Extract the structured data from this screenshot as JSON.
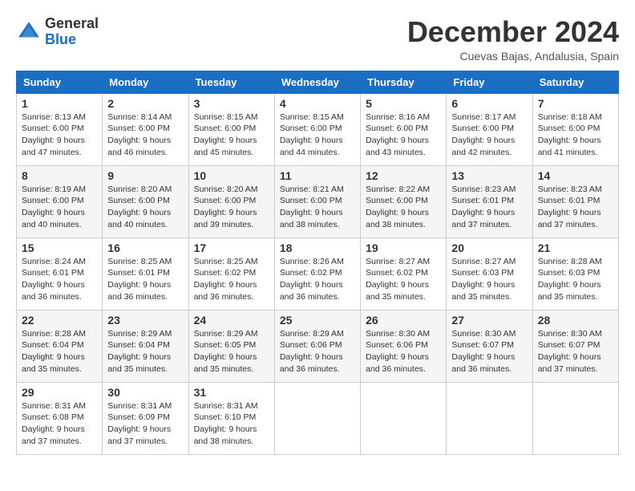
{
  "header": {
    "logo_line1": "General",
    "logo_line2": "Blue",
    "month": "December 2024",
    "location": "Cuevas Bajas, Andalusia, Spain"
  },
  "weekdays": [
    "Sunday",
    "Monday",
    "Tuesday",
    "Wednesday",
    "Thursday",
    "Friday",
    "Saturday"
  ],
  "weeks": [
    [
      {
        "day": 1,
        "sunrise": "8:13 AM",
        "sunset": "6:00 PM",
        "daylight": "9 hours and 47 minutes."
      },
      {
        "day": 2,
        "sunrise": "8:14 AM",
        "sunset": "6:00 PM",
        "daylight": "9 hours and 46 minutes."
      },
      {
        "day": 3,
        "sunrise": "8:15 AM",
        "sunset": "6:00 PM",
        "daylight": "9 hours and 45 minutes."
      },
      {
        "day": 4,
        "sunrise": "8:15 AM",
        "sunset": "6:00 PM",
        "daylight": "9 hours and 44 minutes."
      },
      {
        "day": 5,
        "sunrise": "8:16 AM",
        "sunset": "6:00 PM",
        "daylight": "9 hours and 43 minutes."
      },
      {
        "day": 6,
        "sunrise": "8:17 AM",
        "sunset": "6:00 PM",
        "daylight": "9 hours and 42 minutes."
      },
      {
        "day": 7,
        "sunrise": "8:18 AM",
        "sunset": "6:00 PM",
        "daylight": "9 hours and 41 minutes."
      }
    ],
    [
      {
        "day": 8,
        "sunrise": "8:19 AM",
        "sunset": "6:00 PM",
        "daylight": "9 hours and 40 minutes."
      },
      {
        "day": 9,
        "sunrise": "8:20 AM",
        "sunset": "6:00 PM",
        "daylight": "9 hours and 40 minutes."
      },
      {
        "day": 10,
        "sunrise": "8:20 AM",
        "sunset": "6:00 PM",
        "daylight": "9 hours and 39 minutes."
      },
      {
        "day": 11,
        "sunrise": "8:21 AM",
        "sunset": "6:00 PM",
        "daylight": "9 hours and 38 minutes."
      },
      {
        "day": 12,
        "sunrise": "8:22 AM",
        "sunset": "6:00 PM",
        "daylight": "9 hours and 38 minutes."
      },
      {
        "day": 13,
        "sunrise": "8:23 AM",
        "sunset": "6:01 PM",
        "daylight": "9 hours and 37 minutes."
      },
      {
        "day": 14,
        "sunrise": "8:23 AM",
        "sunset": "6:01 PM",
        "daylight": "9 hours and 37 minutes."
      }
    ],
    [
      {
        "day": 15,
        "sunrise": "8:24 AM",
        "sunset": "6:01 PM",
        "daylight": "9 hours and 36 minutes."
      },
      {
        "day": 16,
        "sunrise": "8:25 AM",
        "sunset": "6:01 PM",
        "daylight": "9 hours and 36 minutes."
      },
      {
        "day": 17,
        "sunrise": "8:25 AM",
        "sunset": "6:02 PM",
        "daylight": "9 hours and 36 minutes."
      },
      {
        "day": 18,
        "sunrise": "8:26 AM",
        "sunset": "6:02 PM",
        "daylight": "9 hours and 36 minutes."
      },
      {
        "day": 19,
        "sunrise": "8:27 AM",
        "sunset": "6:02 PM",
        "daylight": "9 hours and 35 minutes."
      },
      {
        "day": 20,
        "sunrise": "8:27 AM",
        "sunset": "6:03 PM",
        "daylight": "9 hours and 35 minutes."
      },
      {
        "day": 21,
        "sunrise": "8:28 AM",
        "sunset": "6:03 PM",
        "daylight": "9 hours and 35 minutes."
      }
    ],
    [
      {
        "day": 22,
        "sunrise": "8:28 AM",
        "sunset": "6:04 PM",
        "daylight": "9 hours and 35 minutes."
      },
      {
        "day": 23,
        "sunrise": "8:29 AM",
        "sunset": "6:04 PM",
        "daylight": "9 hours and 35 minutes."
      },
      {
        "day": 24,
        "sunrise": "8:29 AM",
        "sunset": "6:05 PM",
        "daylight": "9 hours and 35 minutes."
      },
      {
        "day": 25,
        "sunrise": "8:29 AM",
        "sunset": "6:06 PM",
        "daylight": "9 hours and 36 minutes."
      },
      {
        "day": 26,
        "sunrise": "8:30 AM",
        "sunset": "6:06 PM",
        "daylight": "9 hours and 36 minutes."
      },
      {
        "day": 27,
        "sunrise": "8:30 AM",
        "sunset": "6:07 PM",
        "daylight": "9 hours and 36 minutes."
      },
      {
        "day": 28,
        "sunrise": "8:30 AM",
        "sunset": "6:07 PM",
        "daylight": "9 hours and 37 minutes."
      }
    ],
    [
      {
        "day": 29,
        "sunrise": "8:31 AM",
        "sunset": "6:08 PM",
        "daylight": "9 hours and 37 minutes."
      },
      {
        "day": 30,
        "sunrise": "8:31 AM",
        "sunset": "6:09 PM",
        "daylight": "9 hours and 37 minutes."
      },
      {
        "day": 31,
        "sunrise": "8:31 AM",
        "sunset": "6:10 PM",
        "daylight": "9 hours and 38 minutes."
      },
      null,
      null,
      null,
      null
    ]
  ]
}
